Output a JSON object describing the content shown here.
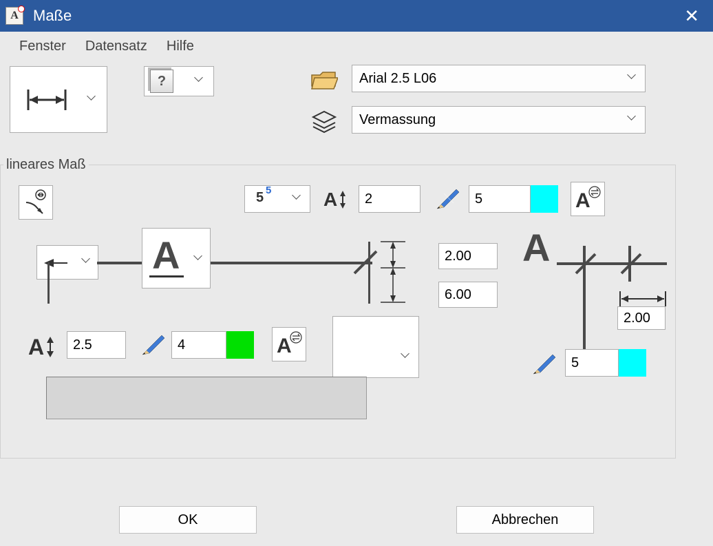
{
  "title": "Maße",
  "menu": {
    "fenster": "Fenster",
    "datensatz": "Datensatz",
    "hilfe": "Hilfe"
  },
  "font_combo": "Arial 2.5 L06",
  "layer_combo": "Vermassung",
  "group_title": "lineares Maß",
  "exp_label_base": "5",
  "exp_label_sup": "5",
  "ah_value": "2",
  "pen_main_value": "5",
  "ref_top": "2.00",
  "ref_bottom": "6.00",
  "ref_right": "2.00",
  "ah2_value": "2.5",
  "pen2_value": "4",
  "pen_right_value": "5",
  "buttons": {
    "ok": "OK",
    "cancel": "Abbrechen"
  },
  "colors": {
    "cyan": "#00FFFF",
    "green": "#00E000"
  }
}
